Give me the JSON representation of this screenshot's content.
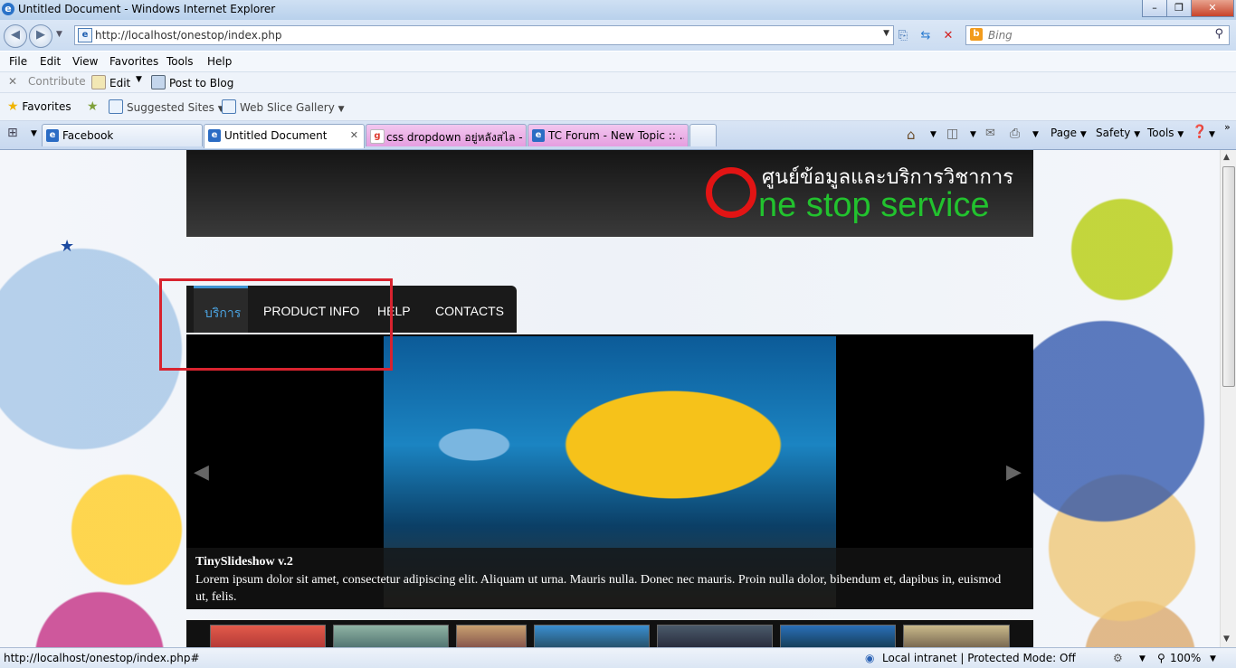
{
  "window": {
    "title": "Untitled Document - Windows Internet Explorer"
  },
  "address": {
    "url": "http://localhost/onestop/index.php"
  },
  "search": {
    "placeholder": "Bing"
  },
  "menu": [
    "File",
    "Edit",
    "View",
    "Favorites",
    "Tools",
    "Help"
  ],
  "command_row": {
    "contribute": "Contribute",
    "edit": "Edit",
    "post_to_blog": "Post to Blog"
  },
  "favorites_bar": {
    "favorites": "Favorites",
    "suggested_sites": "Suggested Sites",
    "web_slice_gallery": "Web Slice Gallery"
  },
  "tabs": [
    {
      "label": "Facebook"
    },
    {
      "label": "Untitled Document"
    },
    {
      "label": "css dropdown อยู่หลังสไล - ..."
    },
    {
      "label": "TC Forum - New Topic :: ..."
    }
  ],
  "right_tools": {
    "page": "Page",
    "safety": "Safety",
    "tools": "Tools"
  },
  "site": {
    "logo_thai": "ศูนย์ข้อมูลและบริการวิชาการ",
    "logo_english": "ne stop service",
    "nav": [
      "บริการ",
      "PRODUCT INFO",
      "HELP",
      "CONTACTS"
    ],
    "slide_title": "TinySlideshow v.2",
    "slide_text": "Lorem ipsum dolor sit amet, consectetur adipiscing elit. Aliquam ut urna. Mauris nulla. Donec nec mauris. Proin nulla dolor, bibendum et, dapibus in, euismod ut, felis."
  },
  "status": {
    "link": "http://localhost/onestop/index.php#",
    "zone": "Local intranet | Protected Mode: Off",
    "zoom": "100%"
  },
  "colors": {
    "nav_active": "#4ba3e0",
    "logo_red": "#e21414",
    "logo_green": "#22c22e",
    "highlight_box": "#d8232f"
  }
}
